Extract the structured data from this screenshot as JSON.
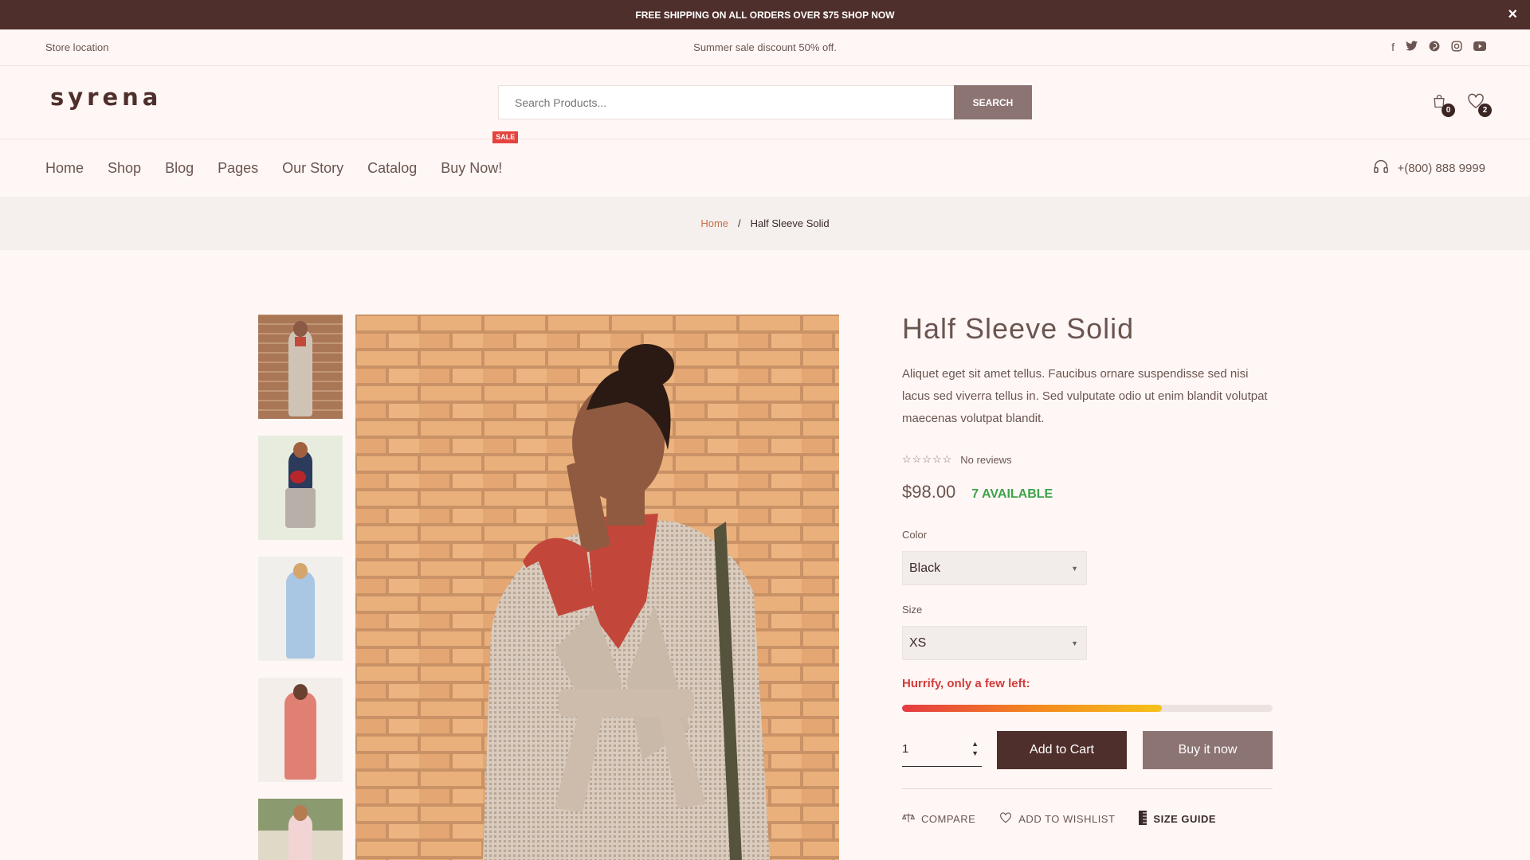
{
  "announcement": {
    "text": "FREE SHIPPING ON ALL ORDERS OVER $75 SHOP NOW",
    "close_icon": "×"
  },
  "topbar": {
    "store_location": "Store location",
    "promo": "Summer sale discount 50% off.",
    "socials": [
      {
        "icon": "facebook-icon",
        "glyph": "f"
      },
      {
        "icon": "twitter-icon",
        "glyph": "🐦"
      },
      {
        "icon": "pinterest-icon",
        "glyph": "ⓟ"
      },
      {
        "icon": "instagram-icon",
        "glyph": "◎"
      },
      {
        "icon": "youtube-icon",
        "glyph": "▶"
      }
    ]
  },
  "header": {
    "logo": "syrena",
    "search_placeholder": "Search Products...",
    "search_button": "SEARCH",
    "cart_count": "0",
    "wishlist_count": "2"
  },
  "nav": {
    "items": [
      "Home",
      "Shop",
      "Blog",
      "Pages",
      "Our Story",
      "Catalog",
      "Buy Now!"
    ],
    "sale_badge": "SALE",
    "phone": "+(800) 888 9999"
  },
  "breadcrumb": {
    "home": "Home",
    "separator": "/",
    "current": "Half Sleeve Solid"
  },
  "product": {
    "title": "Half Sleeve Solid",
    "description": "Aliquet eget sit amet tellus. Faucibus ornare suspendisse sed nisi lacus sed viverra tellus in. Sed vulputate odio ut enim blandit volutpat maecenas volutpat blandit.",
    "stars": "☆☆☆☆☆",
    "reviews": "No reviews",
    "price": "$98.00",
    "availability": "7 AVAILABLE",
    "color_label": "Color",
    "color_value": "Black",
    "size_label": "Size",
    "size_value": "XS",
    "hurry": "Hurrify, only a few left:",
    "stock_progress": 0.7,
    "quantity": "1",
    "add_to_cart": "Add to Cart",
    "buy_now": "Buy it now",
    "compare": "COMPARE",
    "wishlist": "ADD TO WISHLIST",
    "size_guide": "SIZE GUIDE"
  },
  "colors": {
    "brand": "#4f2f2b",
    "muted_button": "#8c7472",
    "available": "#3ea34a",
    "hurry": "#d23b3b"
  }
}
